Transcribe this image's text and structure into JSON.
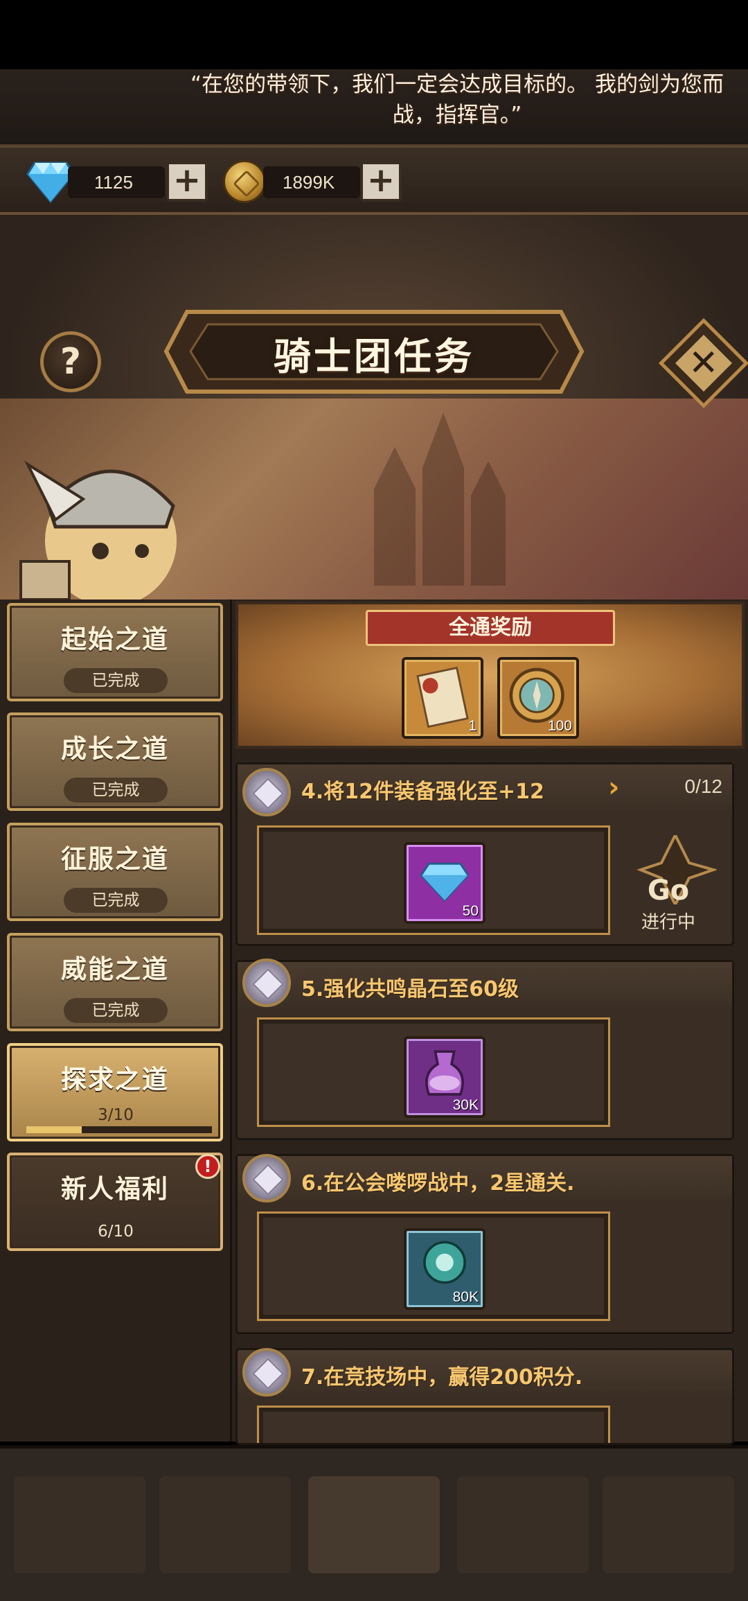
{
  "currency": {
    "diamonds": "1125",
    "gold": "1899K"
  },
  "header": {
    "title": "骑士团任务",
    "quote": "“在您的带领下，我们一定会达成目标的。 我的剑为您而战，指挥官。”"
  },
  "sidebar": {
    "items": [
      {
        "label": "起始之道",
        "status": "已完成"
      },
      {
        "label": "成长之道",
        "status": "已完成"
      },
      {
        "label": "征服之道",
        "status": "已完成"
      },
      {
        "label": "威能之道",
        "status": "已完成"
      },
      {
        "label": "探求之道",
        "status": "3/10",
        "progress": 0.3
      },
      {
        "label": "新人福利",
        "status": "6/10",
        "alert": "!"
      }
    ]
  },
  "full_reward": {
    "label": "全通奖励",
    "items": [
      {
        "icon": "scroll-icon",
        "qty": "1"
      },
      {
        "icon": "compass-icon",
        "qty": "100"
      }
    ]
  },
  "tasks": [
    {
      "title": "4.将12件装备强化至+12",
      "count": "0/12",
      "reward_icon": "diamond-icon",
      "reward_qty": "50",
      "button": "Go",
      "status": "进行中"
    },
    {
      "title": "5.强化共鸣晶石至60级",
      "reward_icon": "potion-icon",
      "reward_qty": "30K"
    },
    {
      "title": "6.在公会喽啰战中，2星通关.",
      "reward_icon": "crystal-icon",
      "reward_qty": "80K"
    },
    {
      "title": "7.在竞技场中，赢得200积分."
    }
  ],
  "colors": {
    "accent": "#f7c770",
    "alert": "#c41d1d",
    "panel": "#3a2e24"
  }
}
